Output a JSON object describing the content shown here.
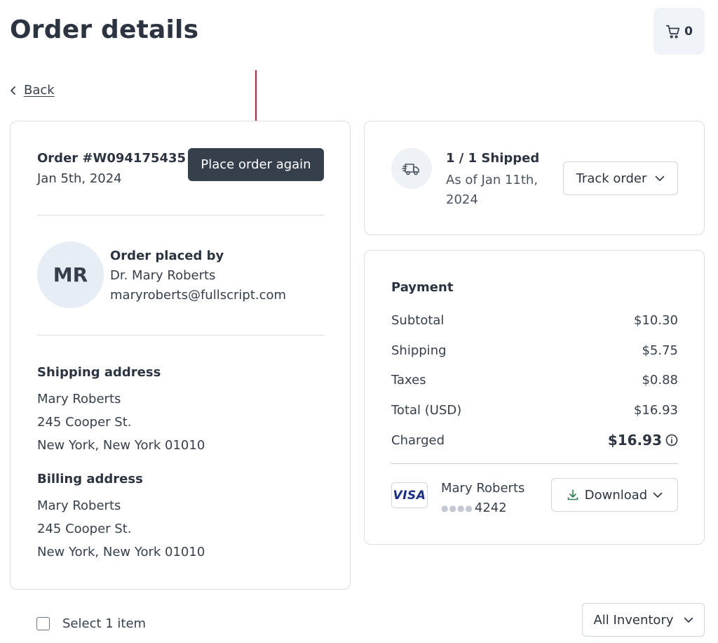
{
  "header": {
    "title": "Order details",
    "cart_count": "0",
    "cart_icon": "cart-icon"
  },
  "nav": {
    "back_label": "Back",
    "back_icon": "chevron-left-icon"
  },
  "order": {
    "number": "Order #W094175435",
    "date": "Jan 5th, 2024",
    "reorder_label": "Place order again"
  },
  "placed_by": {
    "heading": "Order placed by",
    "initials": "MR",
    "name": "Dr. Mary Roberts",
    "email": "maryroberts@fullscript.com"
  },
  "shipping_address": {
    "heading": "Shipping address",
    "lines": [
      "Mary Roberts",
      "245 Cooper St.",
      "New York, New York 01010"
    ]
  },
  "billing_address": {
    "heading": "Billing address",
    "lines": [
      "Mary Roberts",
      "245 Cooper St.",
      "New York, New York 01010"
    ]
  },
  "shipment": {
    "icon": "truck-icon",
    "status": "1 / 1 Shipped",
    "as_of": "As of Jan 11th, 2024",
    "track_label": "Track order"
  },
  "payment": {
    "heading": "Payment",
    "rows": [
      {
        "label": "Subtotal",
        "value": "$10.30"
      },
      {
        "label": "Shipping",
        "value": "$5.75"
      },
      {
        "label": "Taxes",
        "value": "$0.88"
      },
      {
        "label": "Total (USD)",
        "value": "$16.93"
      }
    ],
    "charged_label": "Charged",
    "charged_value": "$16.93",
    "card_brand": "VISA",
    "card_holder": "Mary Roberts",
    "card_last4": "4242",
    "download_label": "Download"
  },
  "items": {
    "select_label": "Select 1 item",
    "inventory_label": "All Inventory"
  },
  "colors": {
    "primary_button": "#36404d",
    "annotation_arrow": "#c0264a",
    "download_icon": "#2e7d4f",
    "visa_blue": "#1a2f8c"
  }
}
